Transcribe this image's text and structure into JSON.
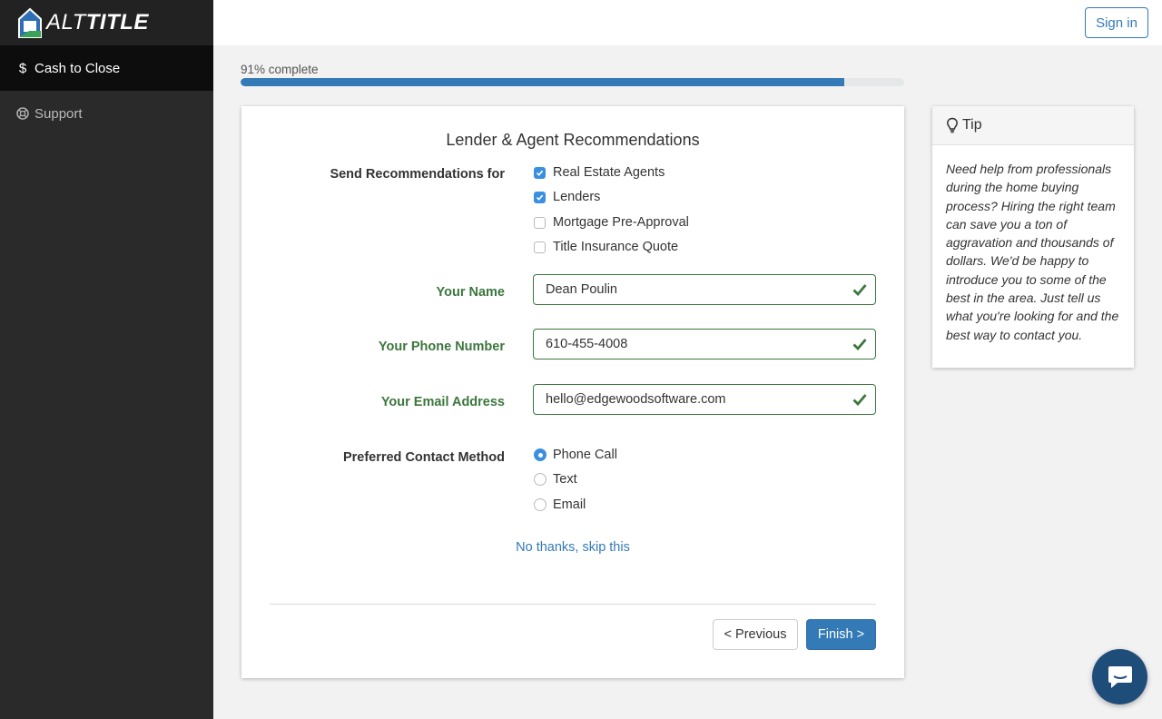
{
  "brand": {
    "name_part1": "ALT",
    "name_part2": "TITLE"
  },
  "sidebar": {
    "items": [
      {
        "label": "Cash to Close",
        "icon": "dollar-icon",
        "active": true
      },
      {
        "label": "Support",
        "icon": "life-ring-icon",
        "active": false
      }
    ]
  },
  "header": {
    "signin_label": "Sign in"
  },
  "progress": {
    "label": "91% complete",
    "percent": 91
  },
  "form": {
    "title": "Lender & Agent Recommendations",
    "recommend_label": "Send Recommendations for",
    "recommend_options": [
      {
        "label": "Real Estate Agents",
        "checked": true
      },
      {
        "label": "Lenders",
        "checked": true
      },
      {
        "label": "Mortgage Pre-Approval",
        "checked": false
      },
      {
        "label": "Title Insurance Quote",
        "checked": false
      }
    ],
    "name_label": "Your Name",
    "name_value": "Dean Poulin",
    "phone_label": "Your Phone Number",
    "phone_value": "610-455-4008",
    "email_label": "Your Email Address",
    "email_value": "hello@edgewoodsoftware.com",
    "contact_label": "Preferred Contact Method",
    "contact_options": [
      {
        "label": "Phone Call",
        "selected": true
      },
      {
        "label": "Text",
        "selected": false
      },
      {
        "label": "Email",
        "selected": false
      }
    ],
    "skip_link": "No thanks, skip this",
    "prev_label": "< Previous",
    "finish_label": "Finish >"
  },
  "tip": {
    "title": "Tip",
    "body": "Need help from professionals during the home buying process? Hiring the right team can save you a ton of aggravation and thousands of dollars. We'd be happy to introduce you to some of the best in the area. Just tell us what you're looking for and the best way to contact you."
  },
  "colors": {
    "accent": "#337ab7",
    "success": "#3c763d",
    "sidebar_bg": "#2a2a2a",
    "checkbox_on": "#3b8fe0"
  }
}
